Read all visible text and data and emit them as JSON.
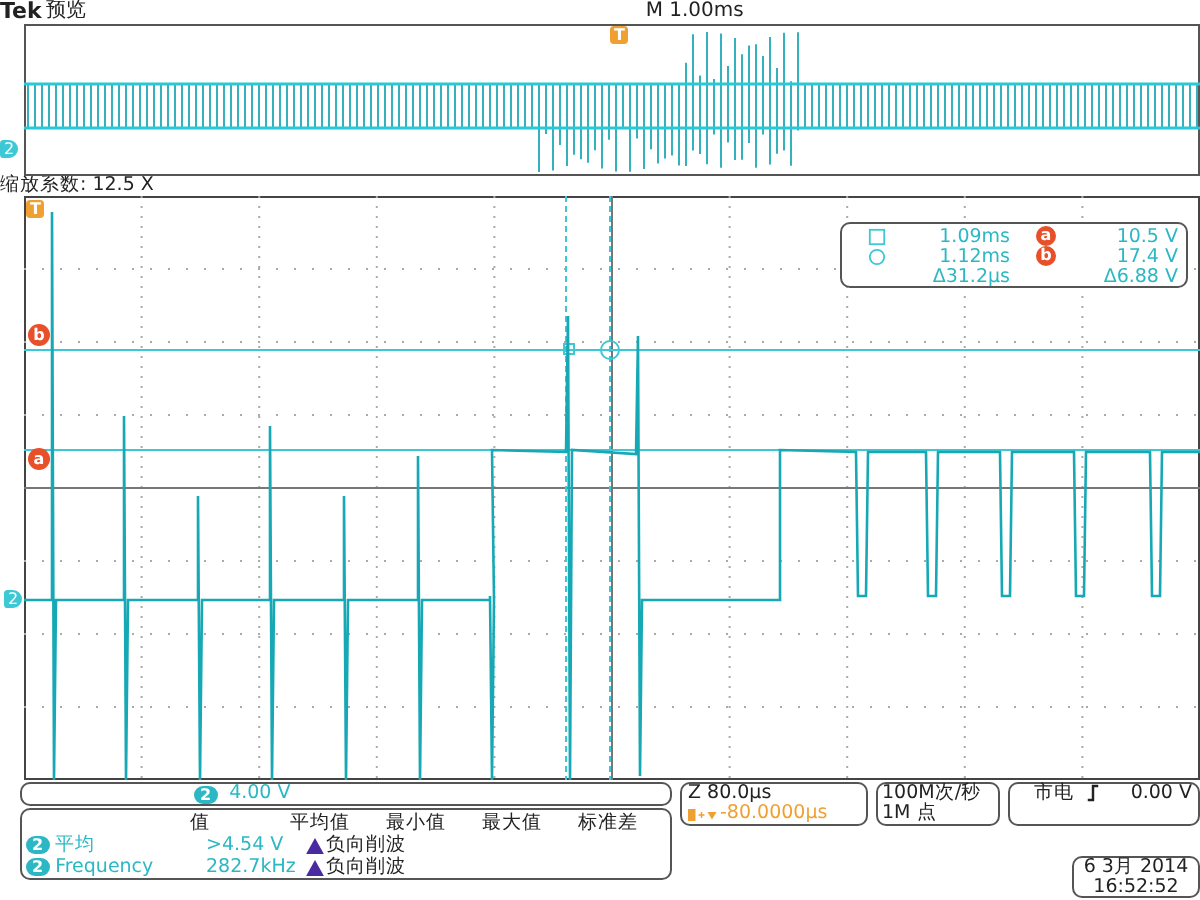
{
  "header": {
    "brand": "Tek",
    "mode": "预览",
    "timebase": "M 1.00ms"
  },
  "overview": {
    "trigger_marker": "T",
    "channel_marker": "2"
  },
  "zoom_label": "缩放系数: 12.5 X",
  "graticule": {
    "trigger_marker": "T",
    "cursor_markers": [
      {
        "label": "b"
      },
      {
        "label": "a"
      }
    ],
    "channel_marker": "2"
  },
  "cursor_readout": {
    "rows": [
      {
        "kind": "square",
        "time": "1.09ms",
        "marker": "a",
        "voltage": "10.5 V"
      },
      {
        "kind": "circle",
        "time": "1.12ms",
        "marker": "b",
        "voltage": "17.4 V"
      },
      {
        "kind": "delta",
        "time": "Δ31.2µs",
        "voltage": "Δ6.88 V"
      }
    ]
  },
  "channel_scale": {
    "channel": "2",
    "scale": "4.00 V"
  },
  "measurements": {
    "columns": [
      "值",
      "平均值",
      "最小值",
      "最大值",
      "标准差"
    ],
    "rows": [
      {
        "channel": "2",
        "name": "平均",
        "value": ">4.54 V",
        "status": "负向削波"
      },
      {
        "channel": "2",
        "name": "Frequency",
        "value": "282.7kHz",
        "status": "负向削波"
      }
    ]
  },
  "horizontal": {
    "zoom": "Z 80.0µs",
    "position": "-80.0000µs"
  },
  "acquisition": {
    "rate": "100M次/秒",
    "points": "1M 点"
  },
  "trigger": {
    "source": "市电",
    "level": "0.00 V"
  },
  "datetime": {
    "date": "6 3月  2014",
    "time": "16:52:52"
  }
}
